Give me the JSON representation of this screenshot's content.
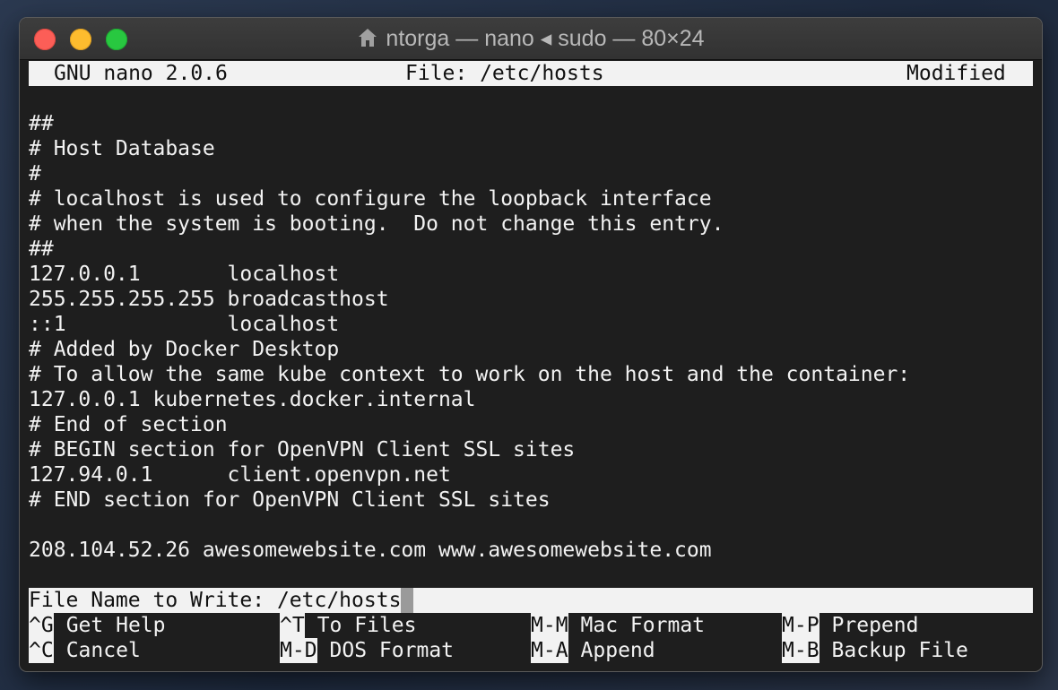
{
  "window": {
    "title": "ntorga — nano ◂ sudo — 80×24"
  },
  "nano_header": {
    "version": "GNU nano 2.0.6",
    "file": "File: /etc/hosts",
    "status": "Modified"
  },
  "file_lines": [
    "",
    "##",
    "# Host Database",
    "#",
    "# localhost is used to configure the loopback interface",
    "# when the system is booting.  Do not change this entry.",
    "##",
    "127.0.0.1       localhost",
    "255.255.255.255 broadcasthost",
    "::1             localhost",
    "# Added by Docker Desktop",
    "# To allow the same kube context to work on the host and the container:",
    "127.0.0.1 kubernetes.docker.internal",
    "# End of section",
    "# BEGIN section for OpenVPN Client SSL sites",
    "127.94.0.1      client.openvpn.net",
    "# END section for OpenVPN Client SSL sites",
    "",
    "208.104.52.26 awesomewebsite.com www.awesomewebsite.com"
  ],
  "prompt": {
    "label": "File Name to Write: /etc/hosts"
  },
  "shortcuts": [
    {
      "key": "^G",
      "label": "Get Help"
    },
    {
      "key": "^T",
      "label": "To Files"
    },
    {
      "key": "M-M",
      "label": "Mac Format"
    },
    {
      "key": "M-P",
      "label": "Prepend"
    },
    {
      "key": "^C",
      "label": "Cancel"
    },
    {
      "key": "M-D",
      "label": "DOS Format"
    },
    {
      "key": "M-A",
      "label": "Append"
    },
    {
      "key": "M-B",
      "label": "Backup File"
    }
  ]
}
